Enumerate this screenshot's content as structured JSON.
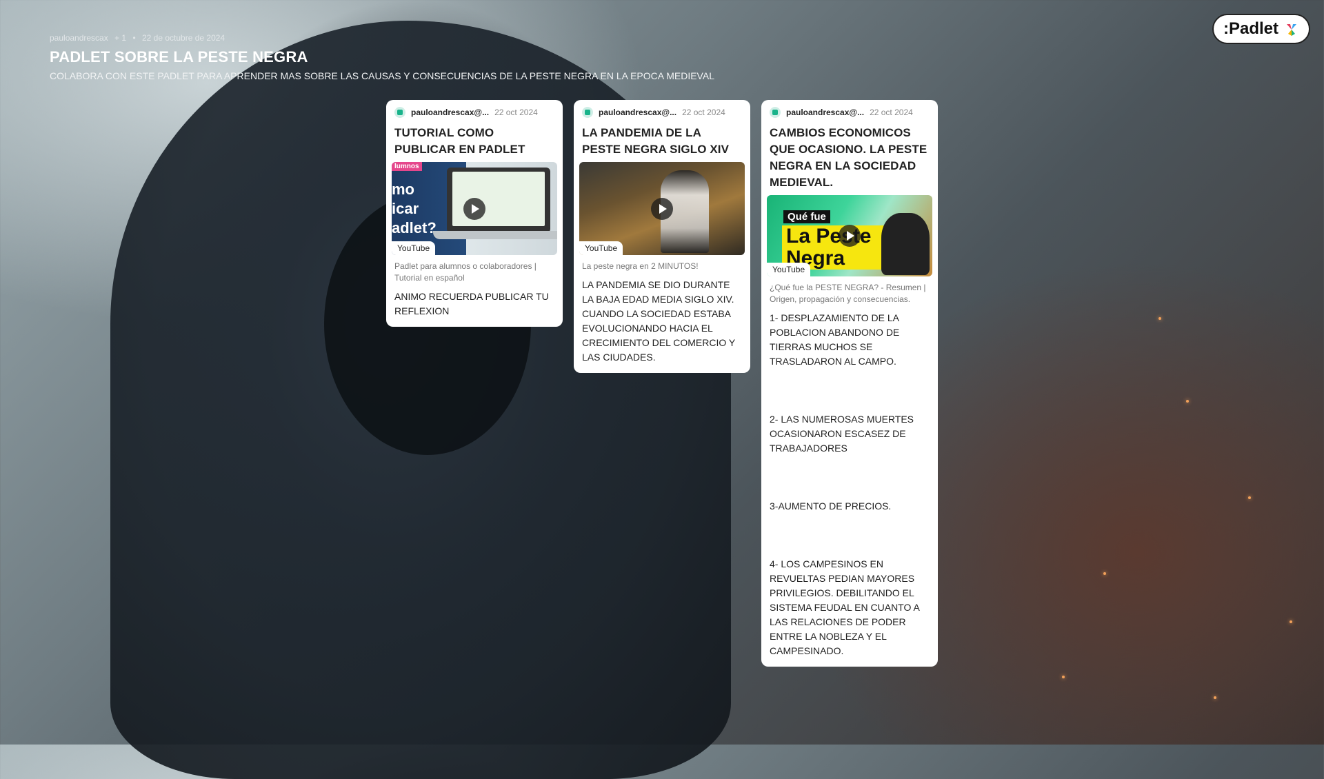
{
  "header": {
    "author": "pauloandrescax",
    "collaborators": "+ 1",
    "bullet": "•",
    "date": "22 de octubre de 2024",
    "title": "PADLET SOBRE LA PESTE NEGRA",
    "subtitle": "COLABORA CON ESTE PADLET PARA APRENDER MAS SOBRE LAS CAUSAS Y CONSECUENCIAS DE LA PESTE NEGRA EN LA EPOCA MEDIEVAL"
  },
  "logo": {
    "text": ":Padlet"
  },
  "colors": {
    "card_bg": "#ffffff",
    "avatar_accent": "#18b38a"
  },
  "posts": [
    {
      "author": "pauloandrescax@...",
      "date": "22 oct 2024",
      "title": "TUTORIAL COMO PUBLICAR EN PADLET",
      "video_source": "YouTube",
      "video_caption": "Padlet para alumnos o colaboradores | Tutorial en español",
      "thumb_tag": "lumnos",
      "thumb_text": "mo\nicar\nadlet?",
      "body": "ANIMO RECUERDA PUBLICAR TU REFLEXION"
    },
    {
      "author": "pauloandrescax@...",
      "date": "22 oct 2024",
      "title": "LA PANDEMIA DE LA PESTE NEGRA SIGLO XIV",
      "video_source": "YouTube",
      "video_caption": "La peste negra en 2 MINUTOS!",
      "body": "LA PANDEMIA SE DIO DURANTE LA BAJA EDAD MEDIA SIGLO XIV. CUANDO LA SOCIEDAD ESTABA EVOLUCIONANDO HACIA EL CRECIMIENTO DEL COMERCIO Y LAS CIUDADES."
    },
    {
      "author": "pauloandrescax@...",
      "date": "22 oct 2024",
      "title": "CAMBIOS ECONOMICOS QUE OCASIONO. LA PESTE NEGRA EN LA SOCIEDAD MEDIEVAL.",
      "video_source": "YouTube",
      "video_caption": "¿Qué fue la PESTE NEGRA? - Resumen | Origen, propagación y consecuencias.",
      "thumb_tag": "Qué fue",
      "thumb_text": "La Peste Negra",
      "body": "1- DESPLAZAMIENTO DE LA POBLACION ABANDONO DE TIERRAS MUCHOS SE TRASLADARON AL CAMPO.\n\n\n\n2- LAS NUMEROSAS MUERTES OCASIONARON ESCASEZ DE TRABAJADORES\n\n\n\n3-AUMENTO DE PRECIOS.\n\n\n\n4- LOS CAMPESINOS EN REVUELTAS PEDIAN MAYORES PRIVILEGIOS.  DEBILITANDO EL SISTEMA FEUDAL EN CUANTO A LAS RELACIONES DE PODER ENTRE LA NOBLEZA Y EL CAMPESINADO."
    }
  ]
}
